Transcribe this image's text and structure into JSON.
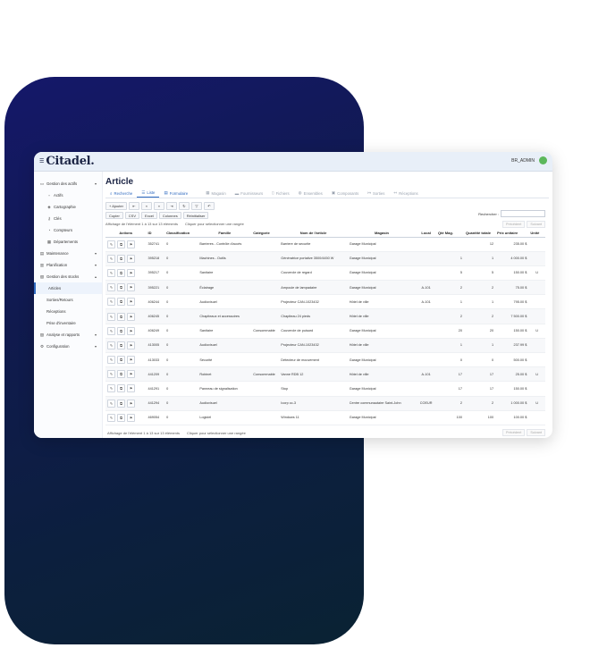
{
  "app": {
    "brand": "Citadel.",
    "user": "BR_ADMIN"
  },
  "sidebar": {
    "items": [
      {
        "label": "Gestion des actifs",
        "icon": "assets-icon"
      },
      {
        "label": "Actifs",
        "icon": "box-icon"
      },
      {
        "label": "Cartographie",
        "icon": "map-icon"
      },
      {
        "label": "Clés",
        "icon": "key-icon"
      },
      {
        "label": "Compteurs",
        "icon": "gauge-icon"
      },
      {
        "label": "Départements",
        "icon": "building-icon"
      },
      {
        "label": "Maintenance",
        "icon": "wrench-icon"
      },
      {
        "label": "Planification",
        "icon": "calendar-icon"
      },
      {
        "label": "Gestion des stocks",
        "icon": "stock-icon"
      },
      {
        "label": "Articles",
        "icon": ""
      },
      {
        "label": "Sorties/Retours",
        "icon": ""
      },
      {
        "label": "Réceptions",
        "icon": ""
      },
      {
        "label": "Prise d'inventaire",
        "icon": ""
      },
      {
        "label": "Analyse et rapports",
        "icon": "chart-icon"
      },
      {
        "label": "Configuration",
        "icon": "gear-icon"
      }
    ]
  },
  "page": {
    "title": "Article"
  },
  "tabs": [
    {
      "label": "Recherche"
    },
    {
      "label": "Liste"
    },
    {
      "label": "Formulaire"
    },
    {
      "label": "Magasin"
    },
    {
      "label": "Fournisseurs"
    },
    {
      "label": "Fichiers"
    },
    {
      "label": "Ensembles"
    },
    {
      "label": "Composants"
    },
    {
      "label": "Sorties"
    },
    {
      "label": "Réceptions"
    }
  ],
  "toolbar": {
    "add": "+ Ajouter",
    "copy": "Copier",
    "csv": "CSV",
    "excel": "Excel",
    "columns": "Colonnes",
    "reset": "Réinitialiser"
  },
  "info": {
    "showing": "Affichage de l'élément 1 à 13 sur 13 éléments",
    "hint": "Cliquer pour sélectionner une rangée"
  },
  "search": {
    "label": "Rechercher :",
    "placeholder": ""
  },
  "pager": {
    "prev": "Précédent",
    "next": "Suivant"
  },
  "table": {
    "headers": [
      "Actions",
      "ID",
      "Classification",
      "Famille",
      "Catégorie",
      "Nom de l'article",
      "Magasin",
      "Local",
      "Qté Mag.",
      "Quantité totale",
      "Prix unitaire",
      "Unité"
    ],
    "rows": [
      [
        "352741",
        "0",
        "Barrieres - Contrôle d'accès",
        "",
        "Barriere de securite",
        "Garage Municipal",
        "",
        "",
        "12",
        "235.00 $",
        ""
      ],
      [
        "395218",
        "0",
        "Machines - Outils",
        "",
        "Génératrice portative 3500/4450 W",
        "Garage Municipal",
        "",
        "1",
        "1",
        "4 000.00 $",
        ""
      ],
      [
        "395217",
        "0",
        "Sanitaire",
        "",
        "Couvercle de regard",
        "Garage Municipal",
        "",
        "5",
        "5",
        "150.00 $",
        "U"
      ],
      [
        "395221",
        "0",
        "Éclairage",
        "",
        "Ampoule de lampadaire",
        "Garage Municipal",
        "A-101",
        "2",
        "2",
        "75.00 $",
        ""
      ],
      [
        "406244",
        "0",
        "Audiovisuel",
        "",
        "Projecteur CAN-1023432",
        "Hôtel de ville",
        "A-101",
        "1",
        "1",
        "795.00 $",
        ""
      ],
      [
        "406245",
        "0",
        "Chapiteaux et accessoires",
        "",
        "Chapiteau 24 pieds",
        "Hôtel de ville",
        "",
        "2",
        "2",
        "7 500.00 $",
        ""
      ],
      [
        "406249",
        "0",
        "Sanitaire",
        "Consommable",
        "Couvercle de puisard",
        "Garage Municipal",
        "",
        "20",
        "20",
        "150.00 $",
        "U"
      ],
      [
        "413005",
        "0",
        "Audiovisuel",
        "",
        "Projecteur CAN-1023432",
        "Hôtel de ville",
        "",
        "1",
        "1",
        "237.99 $",
        ""
      ],
      [
        "413033",
        "0",
        "Sécurité",
        "",
        "Détecteur de mouvement",
        "Garage Municipal",
        "",
        "0",
        "0",
        "500.00 $",
        ""
      ],
      [
        "441209",
        "0",
        "Robinet",
        "Consommable",
        "Vanne RDB 12",
        "Hôtel de ville",
        "A-101",
        "17",
        "17",
        "25.00 $",
        "U"
      ],
      [
        "441291",
        "0",
        "Panneau de signalisation",
        "",
        "Stop",
        "Garage Municipal",
        "",
        "17",
        "17",
        "150.00 $",
        ""
      ],
      [
        "441294",
        "0",
        "Audiovisuel",
        "",
        "Icorp cc-3",
        "Centre communautaire Saint-John",
        "COEUR",
        "2",
        "2",
        "1 000.00 $",
        "U"
      ],
      [
        "469054",
        "0",
        "Logiciel",
        "",
        "Windows 11",
        "Garage Municipal",
        "",
        "100",
        "100",
        "100.00 $",
        ""
      ]
    ]
  },
  "colors": {
    "accent": "#2f6ac0",
    "brand": "#1b2444",
    "avatar": "#5cb85c"
  }
}
